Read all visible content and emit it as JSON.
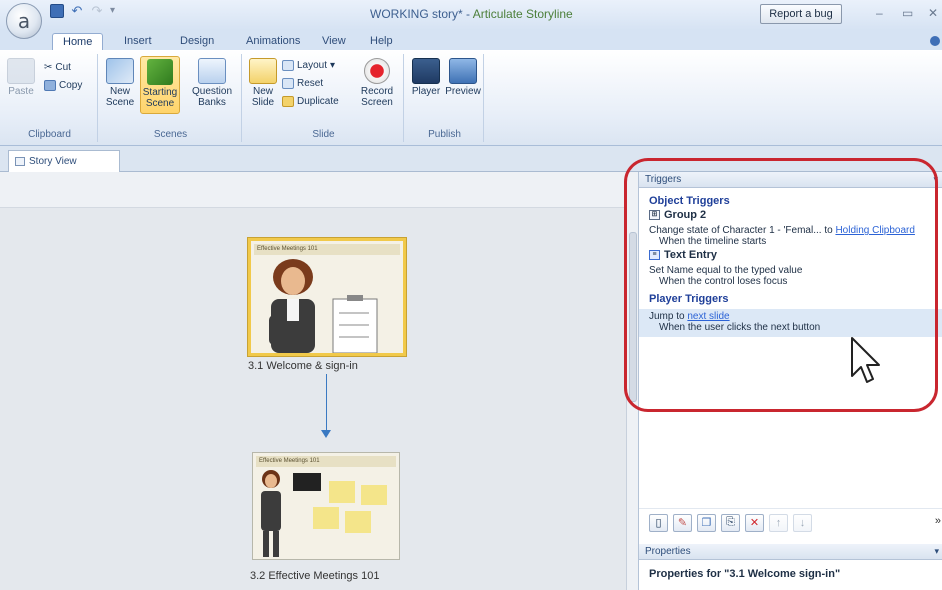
{
  "titlebar": {
    "logo": "a",
    "document_title": "WORKING story* - ",
    "app_name": "Articulate Storyline",
    "report_bug": "Report a bug"
  },
  "ribbon": {
    "tabs": [
      "Home",
      "Insert",
      "Design",
      "Animations",
      "View",
      "Help"
    ],
    "active_tab": "Home",
    "clipboard": {
      "paste": "Paste",
      "cut": "Cut",
      "copy": "Copy",
      "label": "Clipboard"
    },
    "scenes": {
      "new_scene": "New Scene",
      "starting_scene": "Starting Scene",
      "question_banks": "Question Banks",
      "label": "Scenes"
    },
    "slide": {
      "new_slide": "New Slide",
      "layout": "Layout",
      "reset": "Reset",
      "duplicate": "Duplicate",
      "record_screen": "Record Screen",
      "label": "Slide"
    },
    "publish": {
      "player": "Player",
      "preview": "Preview",
      "label": "Publish"
    }
  },
  "doc_tab": {
    "label": "Story View"
  },
  "story": {
    "slides": [
      {
        "header": "Effective Meetings 101",
        "caption": "3.1 Welcome & sign-in",
        "selected": true
      },
      {
        "header": "Effective Meetings 101",
        "caption": "3.2 Effective Meetings 101",
        "selected": false
      }
    ]
  },
  "triggers": {
    "panel_title": "Triggers",
    "object_section": "Object Triggers",
    "items": [
      {
        "object": "Group 2",
        "action_text": "Change state of Character 1 - 'Femal... to ",
        "action_link": "Holding Clipboard",
        "condition": "When the timeline starts"
      },
      {
        "object": "Text Entry",
        "action_text": "Set Name equal to the typed value",
        "action_link": "",
        "condition": "When the control loses focus"
      }
    ],
    "player_section": "Player Triggers",
    "player_item": {
      "action_text": "Jump to ",
      "action_link": "next slide",
      "condition": "When the user clicks the next button"
    }
  },
  "properties": {
    "panel_title": "Properties",
    "title": "Properties for \"3.1 Welcome sign-in\""
  },
  "colors": {
    "highlight_ring": "#c9262f",
    "selected_slide": "#f1c94a",
    "flow_arrow": "#3a79c2",
    "link": "#2c63d6"
  }
}
